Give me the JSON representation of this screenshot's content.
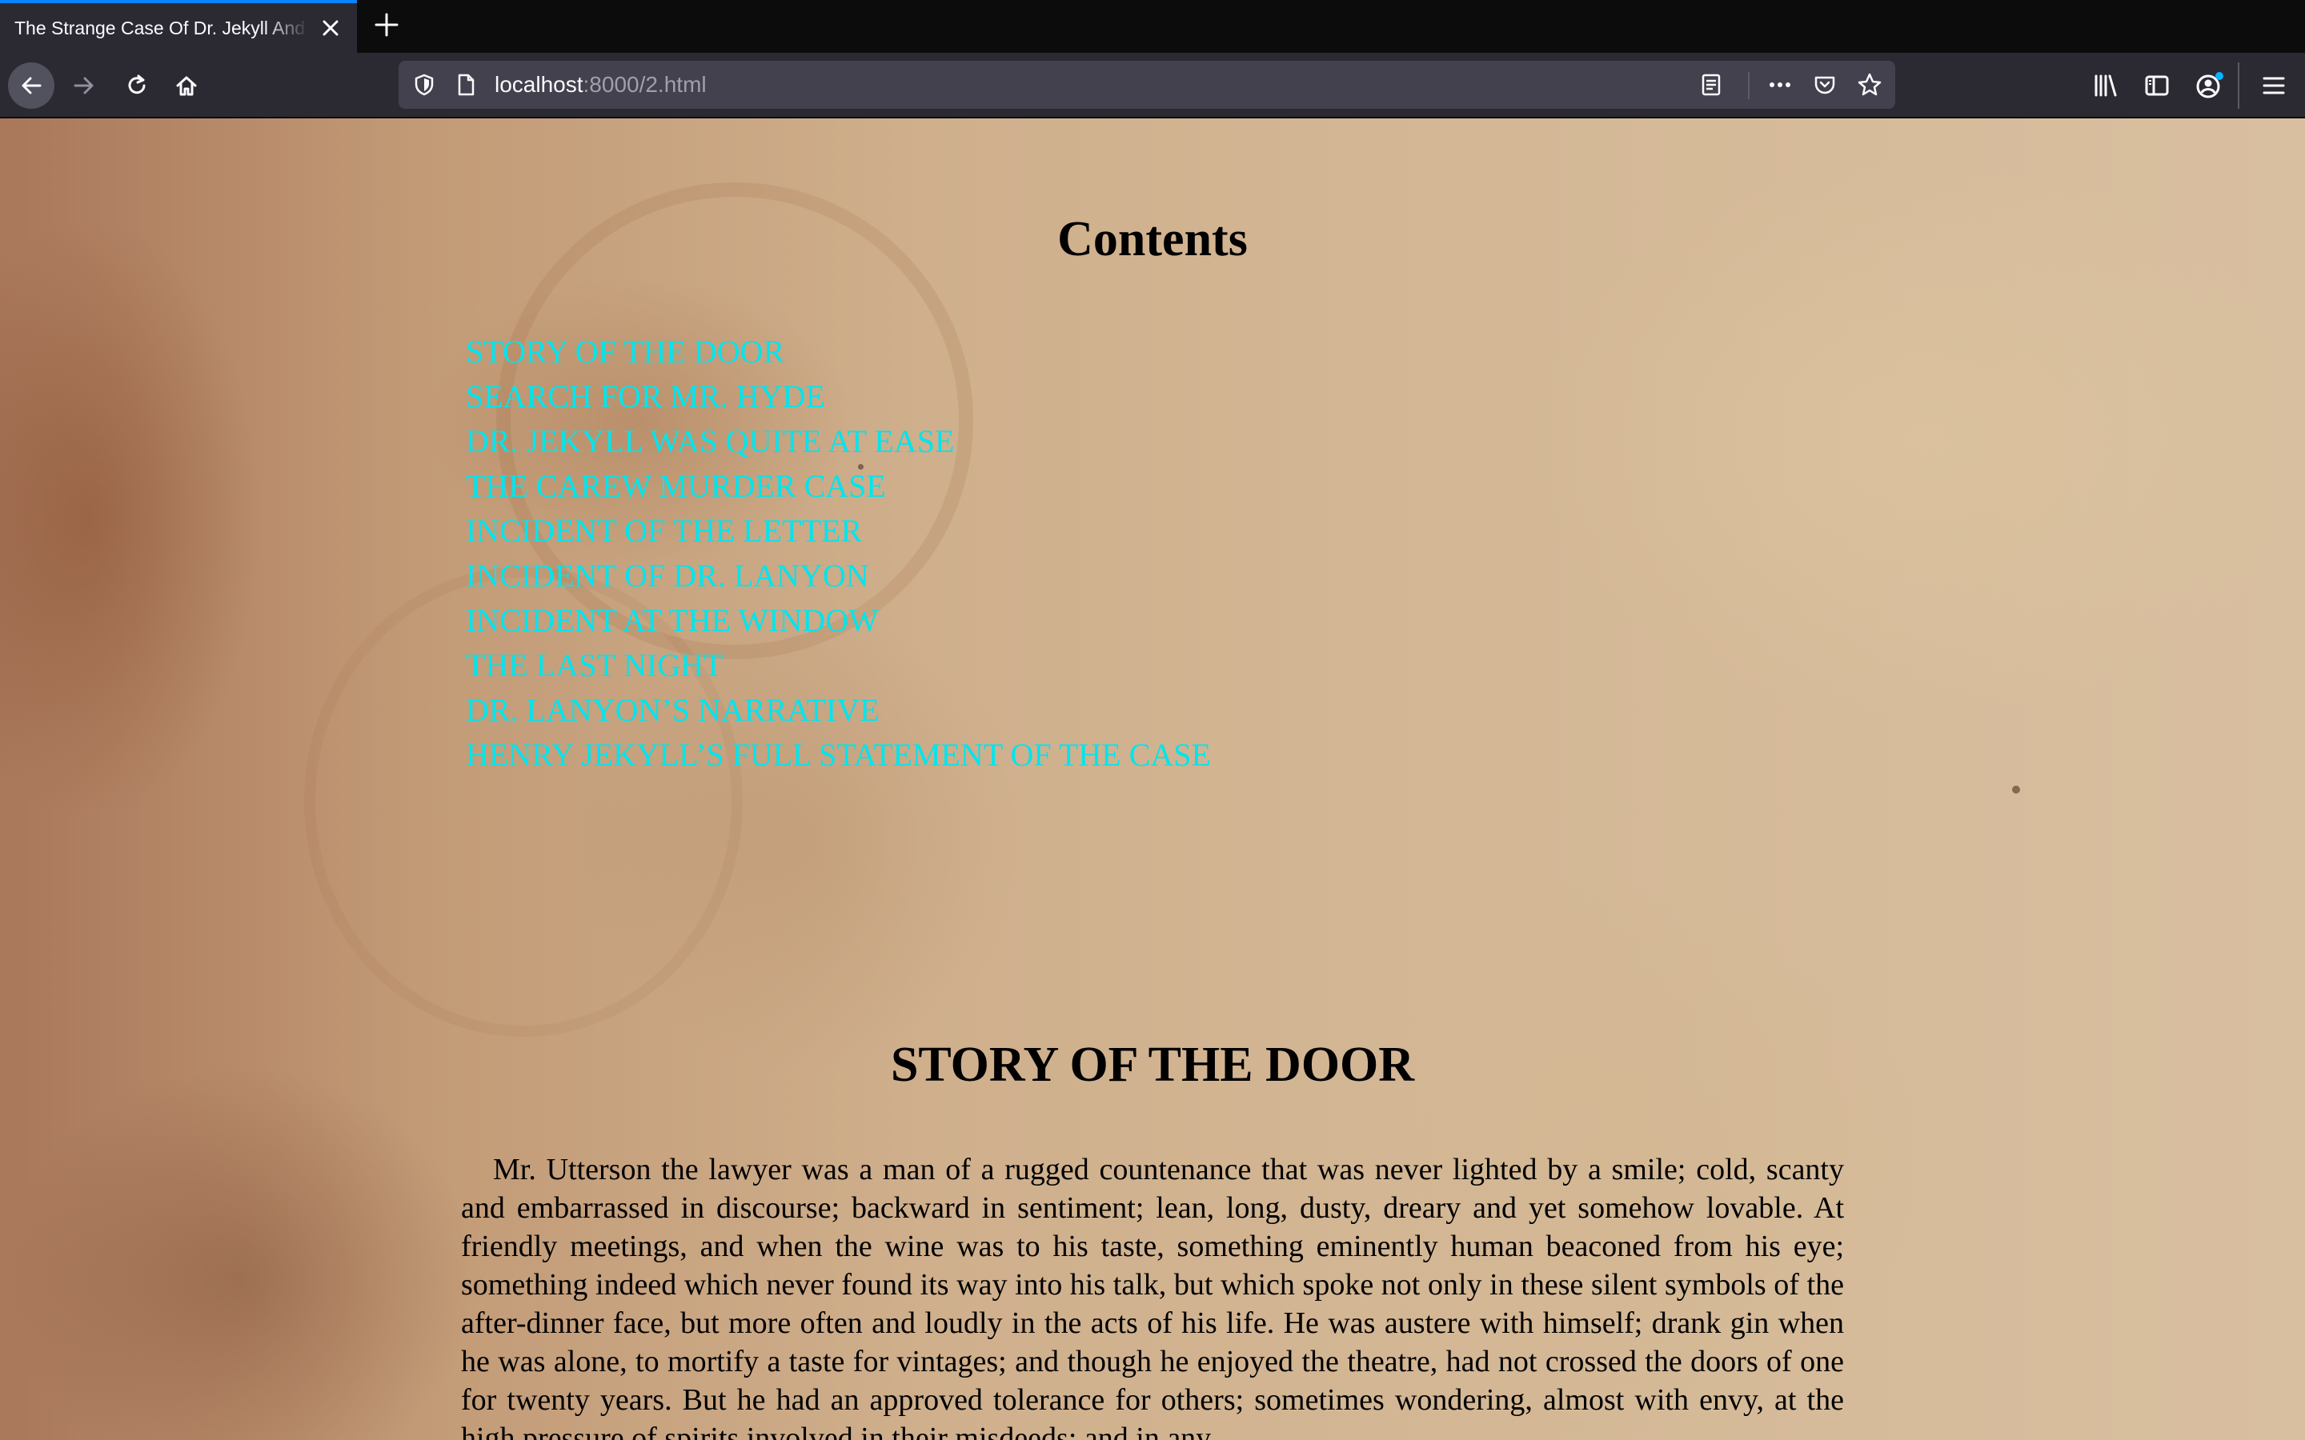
{
  "browser": {
    "tab": {
      "title": "The Strange Case Of Dr. Jekyll And Mr. Hyde"
    },
    "address": {
      "host": "localhost",
      "rest": ":8000/2.html"
    }
  },
  "colors": {
    "link": "#00e5ee",
    "tab_accent": "#0a84ff",
    "toolbar": "#2b2a33"
  },
  "page": {
    "contents_heading": "Contents",
    "toc": [
      "STORY OF THE DOOR",
      "SEARCH FOR MR. HYDE",
      "DR. JEKYLL WAS QUITE AT EASE",
      "THE CAREW MURDER CASE",
      "INCIDENT OF THE LETTER",
      "INCIDENT OF DR. LANYON",
      "INCIDENT AT THE WINDOW",
      "THE LAST NIGHT",
      "DR. LANYON’S NARRATIVE",
      "HENRY JEKYLL’S FULL STATEMENT OF THE CASE"
    ],
    "chapter": {
      "title": "STORY OF THE DOOR",
      "paragraph": "Mr. Utterson the lawyer was a man of a rugged countenance that was never lighted by a smile; cold, scanty and embarrassed in discourse; backward in sentiment; lean, long, dusty, dreary and yet somehow lovable. At friendly meetings, and when the wine was to his taste, something eminently human beaconed from his eye; something indeed which never found its way into his talk, but which spoke not only in these silent symbols of the after-dinner face, but more often and loudly in the acts of his life. He was austere with himself; drank gin when he was alone, to mortify a taste for vintages; and though he enjoyed the theatre, had not crossed the doors of one for twenty years. But he had an approved tolerance for others; sometimes wondering, almost with envy, at the high pressure of spirits involved in their misdeeds; and in any"
    }
  }
}
